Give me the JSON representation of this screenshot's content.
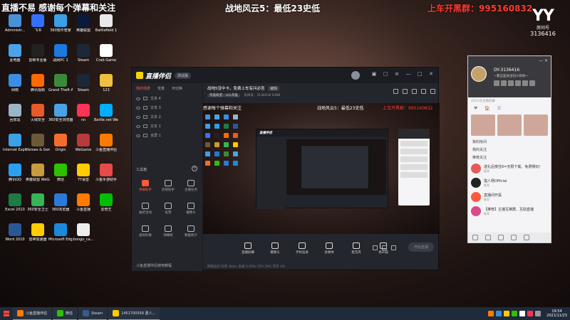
{
  "overlay": {
    "left_text": "直播不易 感谢每个弹幕和关注",
    "center_text": "战地风云5：最低23史低",
    "group_label": "上车开黑群：",
    "group_number": "995160832",
    "room_label": "房间号",
    "room_id": "3136416"
  },
  "desktop_icons": [
    {
      "label": "Administr...",
      "color": "#4a90d9"
    },
    {
      "label": "此电脑",
      "color": "#4aa3e8"
    },
    {
      "label": "网络",
      "color": "#3b8ee0"
    },
    {
      "label": "回收站",
      "color": "#9ab4c8"
    },
    {
      "label": "Internet Explorer",
      "color": "#3aa0e8"
    },
    {
      "label": "腾讯QQ",
      "color": "#2aa0f0"
    },
    {
      "label": "Excel 2010",
      "color": "#1e7b45"
    },
    {
      "label": "Word 2010",
      "color": "#2b5797"
    },
    {
      "label": "飞书",
      "color": "#3370ff"
    },
    {
      "label": "剪映专业版",
      "color": "#222222"
    },
    {
      "label": "腾讯视频",
      "color": "#ff6a00"
    },
    {
      "label": "火绒安全",
      "color": "#e85a2a"
    },
    {
      "label": "Heroes & Generals",
      "color": "#6b5a3a"
    },
    {
      "label": "英雄联盟 WeGame版",
      "color": "#c89b3c"
    },
    {
      "label": "360安全卫士",
      "color": "#35b558"
    },
    {
      "label": "雷神加速器",
      "color": "#ffcc00"
    },
    {
      "label": "360软件管家",
      "color": "#3aa0e8"
    },
    {
      "label": "战网PC 1",
      "color": "#1a7adf"
    },
    {
      "label": "Grand Theft Auto V",
      "color": "#3a8a3a"
    },
    {
      "label": "360安全浏览器",
      "color": "#4aa3e8"
    },
    {
      "label": "Origin",
      "color": "#f56c2d"
    },
    {
      "label": "微信",
      "color": "#2dc100"
    },
    {
      "label": "360浏览器",
      "color": "#2a7ad9"
    },
    {
      "label": "Microsoft Edge",
      "color": "#1a8ad9"
    },
    {
      "label": "英雄联盟",
      "color": "#0a1a3a"
    },
    {
      "label": "Steam",
      "color": "#1b2838"
    },
    {
      "label": "Steam",
      "color": "#1b2838"
    },
    {
      "label": "nn",
      "color": "#ff3355"
    },
    {
      "label": "WeGame",
      "color": "#b83a3a"
    },
    {
      "label": "YY语音",
      "color": "#ffcc00"
    },
    {
      "label": "斗鱼直播",
      "color": "#ff7a00"
    },
    {
      "label": "bongo_ca...",
      "color": "#eeeeee"
    },
    {
      "label": "Battlefield 1",
      "color": "#e8e8e8"
    },
    {
      "label": "Crab Game",
      "color": "#ffffff"
    },
    {
      "label": "123",
      "color": "#f0c040"
    },
    {
      "label": "Battle.net WeGame版",
      "color": "#00aeff"
    },
    {
      "label": "斗鱼直播伴侣",
      "color": "#ff7a00"
    },
    {
      "label": "斗鱼手游助手",
      "color": "#e84a4a"
    },
    {
      "label": "爱奇艺",
      "color": "#00be06"
    }
  ],
  "companion_app": {
    "title": "直播伴侣",
    "version": "测试版",
    "source_tabs": [
      "我的场景",
      "背景",
      "可切换"
    ],
    "sources": [
      "文本 4",
      "文本 3",
      "文本 2",
      "文本 1",
      "全屏 1"
    ],
    "tools_header": "工具箱",
    "tools": [
      {
        "label": "弹幕助手",
        "hot": true
      },
      {
        "label": "房管助手",
        "hot": false
      },
      {
        "label": "主播任务",
        "hot": false
      },
      {
        "label": "抽奖活动",
        "hot": false
      },
      {
        "label": "投票",
        "hot": false
      },
      {
        "label": "摄像头",
        "hot": false
      },
      {
        "label": "虚拟形象",
        "hot": false
      },
      {
        "label": "弹幕姬",
        "hot": false
      },
      {
        "label": "数据统计",
        "hot": false
      }
    ],
    "footer_text": "斗鱼直播伴侣使用教程",
    "stream_title": "战地5没中卡，免费上车有问必答",
    "edit_label": "编辑",
    "meta_tag": "英雄联盟 - LOL英雄",
    "meta_room": "房间号：3136416",
    "meta_fans": "6368",
    "preview_left": "感谢每个弹幕和关注",
    "preview_center": "战地风云5：最低23史低",
    "preview_right": "上车开黑群：995160832",
    "controls": [
      "直播屏幕",
      "摄像头",
      "手机投屏",
      "多媒体",
      "麦克风",
      "扬声器"
    ],
    "start_label": "开始直播",
    "status_text": "网络良好  码率 0kb/s   丢帧 0.00%   CPU 30%   内存 4%"
  },
  "yy_panel": {
    "id_text": "DY-3136416",
    "signature": "~看这里关注别人呀呀~",
    "sub_text": "2021年主播招募",
    "tabs": [
      "♥",
      "🏠",
      "☰"
    ],
    "links": [
      "我的房间",
      "我的关注",
      "推荐关注"
    ],
    "recommendations": [
      {
        "title": "送礼后按住6=无限下载、免费畅玩!",
        "sub": "推荐"
      },
      {
        "title": "猎人杨Official",
        "sub": "推荐"
      },
      {
        "title": "直播间开黑",
        "sub": "推荐"
      },
      {
        "title": "【推荐】主播互推群、互助直播",
        "sub": "推荐"
      }
    ]
  },
  "taskbar": {
    "items": [
      {
        "label": "斗鱼直播伴侣",
        "color": "#ff7a00"
      },
      {
        "label": "微信",
        "color": "#2dc100"
      },
      {
        "label": "Steam",
        "color": "#3a5a8a"
      },
      {
        "label": "1451700556 勇人...",
        "color": "#ffcc00"
      }
    ],
    "tray_icons": [
      "#ff7a00",
      "#3a8ad9",
      "#ffcc00",
      "#2dc100",
      "#ffffff",
      "#ff3355",
      "#999999"
    ],
    "time": "19:54",
    "date": "2021/11/23"
  }
}
